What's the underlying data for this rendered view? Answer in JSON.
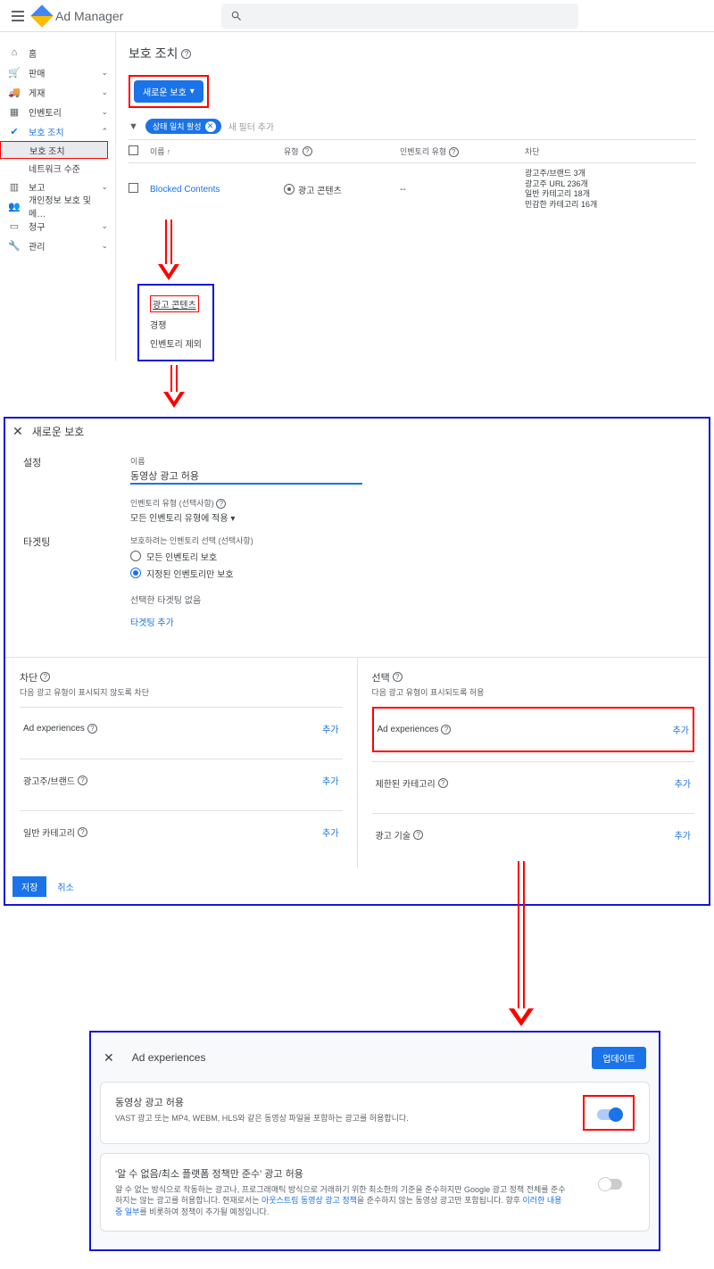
{
  "header": {
    "app_name": "Ad Manager",
    "search_placeholder": ""
  },
  "sidebar": {
    "items": [
      {
        "icon": "home",
        "label": "홈",
        "chev": ""
      },
      {
        "icon": "cart",
        "label": "판매",
        "chev": "⌄"
      },
      {
        "icon": "truck",
        "label": "게재",
        "chev": "⌄"
      },
      {
        "icon": "grid",
        "label": "인벤토리",
        "chev": "⌄"
      },
      {
        "icon": "shield",
        "label": "보호 조치",
        "chev": "⌃",
        "active": true
      },
      {
        "icon": "bar",
        "label": "보고",
        "chev": "⌄"
      },
      {
        "icon": "people",
        "label": "개인정보 보호 및 메…",
        "chev": ""
      },
      {
        "icon": "card",
        "label": "청구",
        "chev": "⌄"
      },
      {
        "icon": "wrench",
        "label": "관리",
        "chev": "⌄"
      }
    ],
    "sub": {
      "protect": "보호 조치",
      "network": "네트워크 수준"
    }
  },
  "page": {
    "title": "보호 조치",
    "new_button": "새로운 보호",
    "filter_chip": "상태 일치 활성",
    "add_filter": "새 필터 추가",
    "columns": {
      "name": "이름",
      "type": "유형",
      "inv": "인벤토리 유형",
      "block": "차단"
    },
    "row": {
      "name": "Blocked Contents",
      "type": "광고 콘텐츠",
      "inv": "--",
      "blocks": [
        "광고주/브랜드 3개",
        "광고주 URL 236개",
        "일반 카테고리 18개",
        "민감한 카테고리 16개"
      ]
    }
  },
  "dropdown": {
    "ad_content": "광고 콘텐츠",
    "competition": "경쟁",
    "inv_exclude": "인벤토리 제외"
  },
  "panel": {
    "title": "새로운 보호",
    "settings_label": "설정",
    "name_label": "이름",
    "name_value": "동영상 광고 허용",
    "inv_type_label": "인벤토리 유형 (선택사항)",
    "inv_type_value": "모든 인벤토리 유형에 적용",
    "targeting_label": "타겟팅",
    "targeting_desc": "보호하려는 인벤토리 선택 (선택사항)",
    "radio_all": "모든 인벤토리 보호",
    "radio_specific": "지정된 인벤토리만 보호",
    "no_targeting": "선택한 타겟팅 없음",
    "add_targeting": "타겟팅 추가",
    "block": {
      "title": "차단",
      "sub": "다음 광고 유형이 표시되지 않도록 차단"
    },
    "allow": {
      "title": "선택",
      "sub": "다음 광고 유형이 표시되도록 허용"
    },
    "items": {
      "ad_exp": "Ad experiences",
      "advertiser": "광고주/브랜드",
      "general_cat": "일반 카테고리",
      "restricted_cat": "제한된 카테고리",
      "ad_tech": "광고 기술",
      "add": "추가"
    },
    "save": "저장",
    "cancel": "취소"
  },
  "modal": {
    "title": "Ad experiences",
    "update": "업데이트",
    "card1": {
      "title": "동영상 광고 허용",
      "desc": "VAST 광고 또는 MP4, WEBM, HLS와 같은 동영상 파일을 포함하는 광고를 허용합니다."
    },
    "card2": {
      "title": "'알 수 없음/최소 플랫폼 정책만 준수' 광고 허용",
      "desc_p1": "알 수 없는 방식으로 작동하는 광고나, 프로그래매틱 방식으로 거래하기 위한 최소한의 기준을 준수하지만 Google 광고 정책 전체를 준수하지는 않는 광고를 허용합니다. 현재로서는 ",
      "link1": "아웃스트림 동영상 광고 정책",
      "desc_p2": "을 준수하지 않는 동영상 광고만 포함됩니다. 향후 ",
      "link2": "이러한 내용 중 일부",
      "desc_p3": "를 비롯하여 정책이 추가될 예정입니다."
    }
  }
}
